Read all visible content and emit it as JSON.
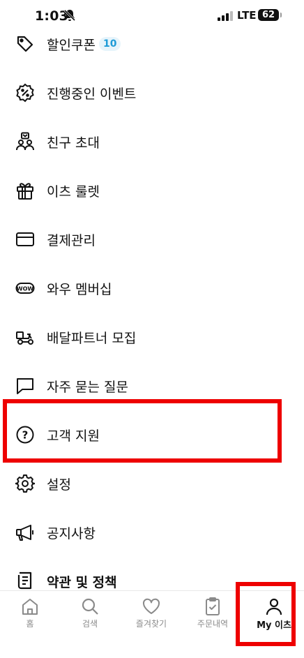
{
  "status_bar": {
    "time": "1:03",
    "network": "LTE",
    "battery": "62"
  },
  "menu": {
    "items": [
      {
        "label": "할인쿠폰",
        "badge": "10",
        "icon": "coupon-tag-icon"
      },
      {
        "label": "진행중인 이벤트",
        "icon": "percent-badge-icon"
      },
      {
        "label": "친구 초대",
        "icon": "invite-friends-icon"
      },
      {
        "label": "이츠 룰렛",
        "icon": "gift-box-icon"
      },
      {
        "label": "결제관리",
        "icon": "credit-card-icon"
      },
      {
        "label": "와우 멤버십",
        "icon": "wow-membership-icon"
      },
      {
        "label": "배달파트너 모집",
        "icon": "delivery-scooter-icon"
      },
      {
        "label": "자주 묻는 질문",
        "icon": "chat-bubble-icon"
      },
      {
        "label": "고객 지원",
        "icon": "question-circle-icon"
      },
      {
        "label": "설정",
        "icon": "gear-icon"
      },
      {
        "label": "공지사항",
        "icon": "megaphone-icon"
      },
      {
        "label": "약관 및 정책",
        "icon": "document-icon"
      }
    ]
  },
  "tabs": [
    {
      "label": "홈",
      "icon": "home-icon"
    },
    {
      "label": "검색",
      "icon": "search-icon"
    },
    {
      "label": "즐겨찾기",
      "icon": "heart-icon"
    },
    {
      "label": "주문내역",
      "icon": "clipboard-check-icon"
    },
    {
      "label": "My 이츠",
      "icon": "person-icon",
      "active": true
    }
  ],
  "colors": {
    "highlight": "#ee0000",
    "badge_text": "#1e9bd7",
    "badge_bg": "#e6f4fb"
  }
}
